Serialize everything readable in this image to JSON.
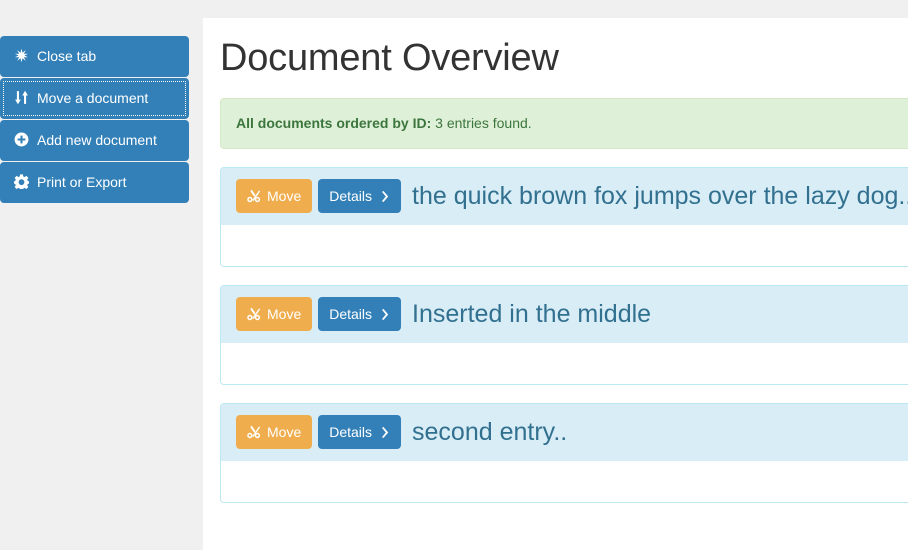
{
  "sidebar": {
    "items": [
      {
        "label": "Close tab",
        "icon": "asterisk-icon",
        "name": "close-tab",
        "focused": false
      },
      {
        "label": "Move a document",
        "icon": "sort-updown-icon",
        "name": "move-a-document",
        "focused": true
      },
      {
        "label": "Add new document",
        "icon": "plus-circle-icon",
        "name": "add-new-document",
        "focused": false
      },
      {
        "label": "Print or Export",
        "icon": "gear-icon",
        "name": "print-or-export",
        "focused": false
      }
    ]
  },
  "main": {
    "title": "Document Overview",
    "alert": {
      "strong": "All documents ordered by ID:",
      "text": " 3 entries found."
    },
    "buttons": {
      "move_label": "Move",
      "details_label": "Details"
    },
    "documents": [
      {
        "title": "the quick brown fox jumps over the lazy dog.."
      },
      {
        "title": "Inserted in the middle"
      },
      {
        "title": "second entry.."
      }
    ]
  },
  "colors": {
    "page_background": "#f0f0f0",
    "panel_background": "#ffffff",
    "primary_blue": "#3380b8",
    "warning_orange": "#efad4d",
    "info_light_blue": "#d9edf7",
    "info_border": "#bce8f1",
    "info_text": "#31708f",
    "success_background": "#dff0d8",
    "success_border": "#d6e9c6",
    "success_text": "#3c763d",
    "title_text": "#333333"
  }
}
